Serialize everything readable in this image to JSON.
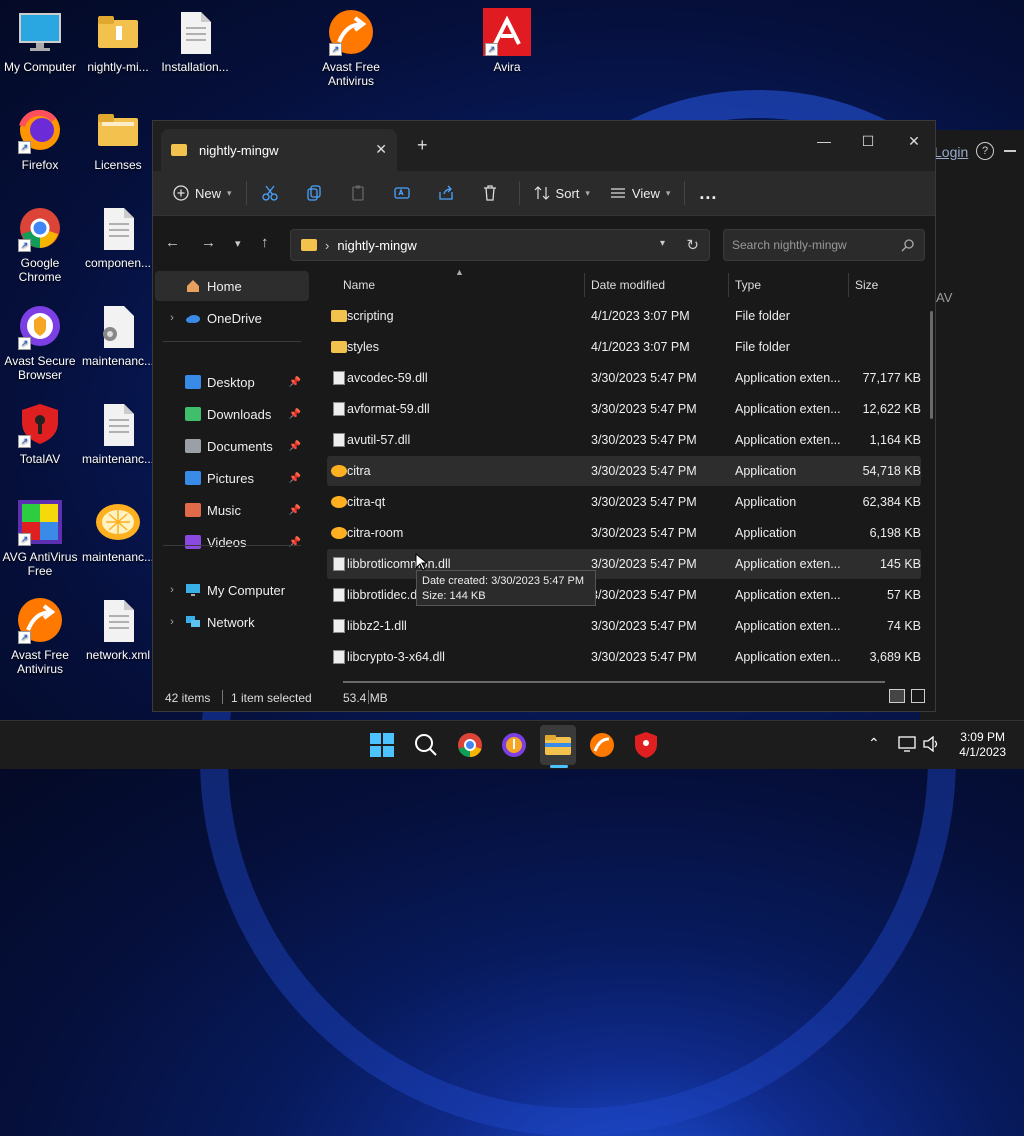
{
  "desktop": {
    "icons": [
      {
        "label": "My Computer"
      },
      {
        "label": "nightly-mi..."
      },
      {
        "label": "Installation..."
      },
      {
        "label": "Avast Free Antivirus"
      },
      {
        "label": "Avira"
      },
      {
        "label": "Firefox"
      },
      {
        "label": "Licenses"
      },
      {
        "label": "Google Chrome"
      },
      {
        "label": "componen..."
      },
      {
        "label": "Avast Secure Browser"
      },
      {
        "label": "maintenanc..."
      },
      {
        "label": "TotalAV"
      },
      {
        "label": "maintenanc..."
      },
      {
        "label": "AVG AntiVirus Free"
      },
      {
        "label": "maintenanc..."
      },
      {
        "label": "Avast Free Antivirus"
      },
      {
        "label": "network.xml"
      }
    ]
  },
  "background_app": {
    "login": "Login",
    "help": "?",
    "frag": "AV"
  },
  "explorer": {
    "tab_title": "nightly-mingw",
    "toolbar": {
      "new": "New",
      "sort": "Sort",
      "view": "View",
      "more": "..."
    },
    "address": {
      "folder": "nightly-mingw",
      "sep": "›"
    },
    "search_placeholder": "Search nightly-mingw",
    "sidebar": {
      "home": "Home",
      "onedrive": "OneDrive",
      "quick": [
        {
          "label": "Desktop",
          "color": "#3a8be8"
        },
        {
          "label": "Downloads",
          "color": "#3fbf6b"
        },
        {
          "label": "Documents",
          "color": "#9aa0a6"
        },
        {
          "label": "Pictures",
          "color": "#3a8be8"
        },
        {
          "label": "Music",
          "color": "#e06a4a"
        },
        {
          "label": "Videos",
          "color": "#8a4ae0"
        }
      ],
      "my_computer": "My Computer",
      "network": "Network"
    },
    "columns": {
      "name": "Name",
      "date": "Date modified",
      "type": "Type",
      "size": "Size"
    },
    "files": [
      {
        "name": "scripting",
        "date": "4/1/2023 3:07 PM",
        "type": "File folder",
        "size": "",
        "kind": "folder"
      },
      {
        "name": "styles",
        "date": "4/1/2023 3:07 PM",
        "type": "File folder",
        "size": "",
        "kind": "folder"
      },
      {
        "name": "avcodec-59.dll",
        "date": "3/30/2023 5:47 PM",
        "type": "Application exten...",
        "size": "77,177 KB",
        "kind": "dll"
      },
      {
        "name": "avformat-59.dll",
        "date": "3/30/2023 5:47 PM",
        "type": "Application exten...",
        "size": "12,622 KB",
        "kind": "dll"
      },
      {
        "name": "avutil-57.dll",
        "date": "3/30/2023 5:47 PM",
        "type": "Application exten...",
        "size": "1,164 KB",
        "kind": "dll"
      },
      {
        "name": "citra",
        "date": "3/30/2023 5:47 PM",
        "type": "Application",
        "size": "54,718 KB",
        "kind": "app"
      },
      {
        "name": "citra-qt",
        "date": "3/30/2023 5:47 PM",
        "type": "Application",
        "size": "62,384 KB",
        "kind": "app"
      },
      {
        "name": "citra-room",
        "date": "3/30/2023 5:47 PM",
        "type": "Application",
        "size": "6,198 KB",
        "kind": "app"
      },
      {
        "name": "libbrotlicommon.dll",
        "date": "3/30/2023 5:47 PM",
        "type": "Application exten...",
        "size": "145 KB",
        "kind": "dll"
      },
      {
        "name": "libbrotlidec.dll",
        "date": "3/30/2023 5:47 PM",
        "type": "Application exten...",
        "size": "57 KB",
        "kind": "dll"
      },
      {
        "name": "libbz2-1.dll",
        "date": "3/30/2023 5:47 PM",
        "type": "Application exten...",
        "size": "74 KB",
        "kind": "dll"
      },
      {
        "name": "libcrypto-3-x64.dll",
        "date": "3/30/2023 5:47 PM",
        "type": "Application exten...",
        "size": "3,689 KB",
        "kind": "dll"
      }
    ],
    "tooltip": {
      "line1": "Date created: 3/30/2023 5:47 PM",
      "line2": "Size: 144 KB"
    },
    "status": {
      "items": "42 items",
      "selected": "1 item selected",
      "size": "53.4 MB"
    }
  },
  "taskbar": {
    "time": "3:09 PM",
    "date": "4/1/2023"
  },
  "colors": {
    "folder": "#f2c14e",
    "accent": "#0067c0"
  }
}
